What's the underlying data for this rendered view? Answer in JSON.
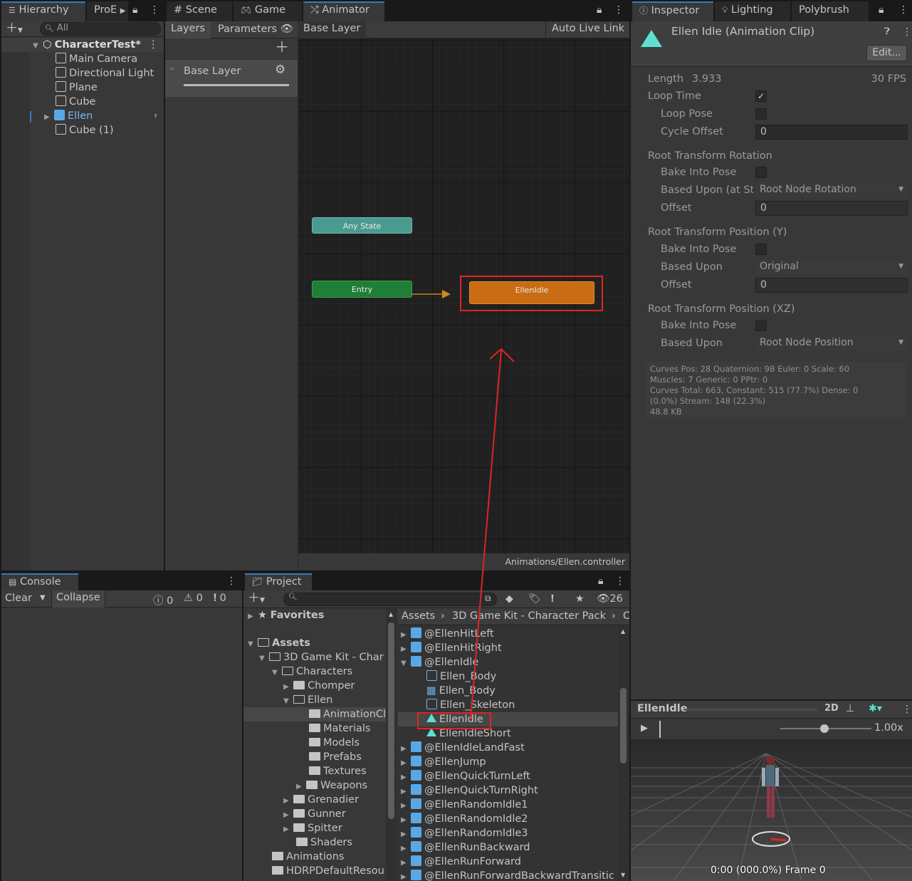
{
  "hierarchy": {
    "tabs": [
      "Hierarchy",
      "ProE"
    ],
    "search_placeholder": "All",
    "scene": "CharacterTest*",
    "items": [
      "Main Camera",
      "Directional Light",
      "Plane",
      "Cube",
      "Ellen",
      "Cube (1)"
    ]
  },
  "center_tabs": [
    "Scene",
    "Game",
    "Animator"
  ],
  "animator": {
    "layers_tab": "Layers",
    "parameters_tab": "Parameters",
    "breadcrumb": "Base Layer",
    "auto_live_link": "Auto Live Link",
    "layer_name": "Base Layer",
    "nodes": {
      "any_state": "Any State",
      "entry": "Entry",
      "ellen_idle": "EllenIdle"
    },
    "footer": "Animations/Ellen.controller"
  },
  "inspector": {
    "tabs": [
      "Inspector",
      "Lighting",
      "Polybrush"
    ],
    "title": "Ellen Idle (Animation Clip)",
    "edit_button": "Edit...",
    "length_label": "Length",
    "length_value": "3.933",
    "fps": "30 FPS",
    "loop_time": "Loop Time",
    "loop_pose": "Loop Pose",
    "cycle_offset": "Cycle Offset",
    "cycle_offset_value": "0",
    "rtr_header": "Root Transform Rotation",
    "rtr_bake": "Bake Into Pose",
    "rtr_based": "Based Upon (at St",
    "rtr_based_value": "Root Node Rotation",
    "rtr_offset": "Offset",
    "rtr_offset_value": "0",
    "rty_header": "Root Transform Position (Y)",
    "rty_bake": "Bake Into Pose",
    "rty_based": "Based Upon",
    "rty_based_value": "Original",
    "rty_offset": "Offset",
    "rty_offset_value": "0",
    "rtxz_header": "Root Transform Position (XZ)",
    "rtxz_bake": "Bake Into Pose",
    "rtxz_based": "Based Upon",
    "rtxz_based_value": "Root Node Position",
    "stats": [
      "Curves Pos: 28 Quaternion: 98 Euler: 0 Scale: 60",
      "Muscles: 7 Generic: 0 PPtr: 0",
      "Curves Total: 663, Constant: 515 (77.7%) Dense: 0",
      "(0.0%) Stream: 148 (22.3%)",
      "48.8 KB"
    ]
  },
  "preview": {
    "name": "EllenIdle",
    "mode_2d": "2D",
    "speed": "1.00x",
    "timecode": "0:00 (000.0%) Frame 0"
  },
  "console": {
    "tab": "Console",
    "clear": "Clear",
    "collapse": "Collapse",
    "errors": "0",
    "warnings": "0",
    "messages": "0"
  },
  "project": {
    "tab": "Project",
    "visible_count": "26",
    "favorites": "Favorites",
    "tree": [
      {
        "label": "Assets",
        "indent": 0
      },
      {
        "label": "3D Game Kit - Char",
        "indent": 1
      },
      {
        "label": "Characters",
        "indent": 2
      },
      {
        "label": "Chomper",
        "indent": 3
      },
      {
        "label": "Ellen",
        "indent": 3
      },
      {
        "label": "AnimationCl",
        "indent": 4
      },
      {
        "label": "Materials",
        "indent": 4
      },
      {
        "label": "Models",
        "indent": 4
      },
      {
        "label": "Prefabs",
        "indent": 4
      },
      {
        "label": "Textures",
        "indent": 4
      },
      {
        "label": "Weapons",
        "indent": 4
      },
      {
        "label": "Grenadier",
        "indent": 3
      },
      {
        "label": "Gunner",
        "indent": 3
      },
      {
        "label": "Spitter",
        "indent": 3
      },
      {
        "label": "Shaders",
        "indent": 2
      },
      {
        "label": "Animations",
        "indent": 1
      },
      {
        "label": "HDRPDefaultResou",
        "indent": 1
      }
    ],
    "breadcrumb": [
      "Assets",
      "3D Game Kit - Character Pack",
      "C"
    ],
    "files": [
      {
        "label": "@EllenHitLeft",
        "type": "model"
      },
      {
        "label": "@EllenHitRight",
        "type": "model"
      },
      {
        "label": "@EllenIdle",
        "type": "model-open"
      },
      {
        "label": "Ellen_Body",
        "type": "mesh"
      },
      {
        "label": "Ellen_Body",
        "type": "grid"
      },
      {
        "label": "Ellen_Skeleton",
        "type": "mesh"
      },
      {
        "label": "EllenIdle",
        "type": "anim"
      },
      {
        "label": "EllenIdleShort",
        "type": "anim"
      },
      {
        "label": "@EllenIdleLandFast",
        "type": "model"
      },
      {
        "label": "@EllenJump",
        "type": "model"
      },
      {
        "label": "@EllenQuickTurnLeft",
        "type": "model"
      },
      {
        "label": "@EllenQuickTurnRight",
        "type": "model"
      },
      {
        "label": "@EllenRandomIdle1",
        "type": "model"
      },
      {
        "label": "@EllenRandomIdle2",
        "type": "model"
      },
      {
        "label": "@EllenRandomIdle3",
        "type": "model"
      },
      {
        "label": "@EllenRunBackward",
        "type": "model"
      },
      {
        "label": "@EllenRunForward",
        "type": "model"
      },
      {
        "label": "@EllenRunForwardBackwardTransitic",
        "type": "model"
      }
    ]
  }
}
